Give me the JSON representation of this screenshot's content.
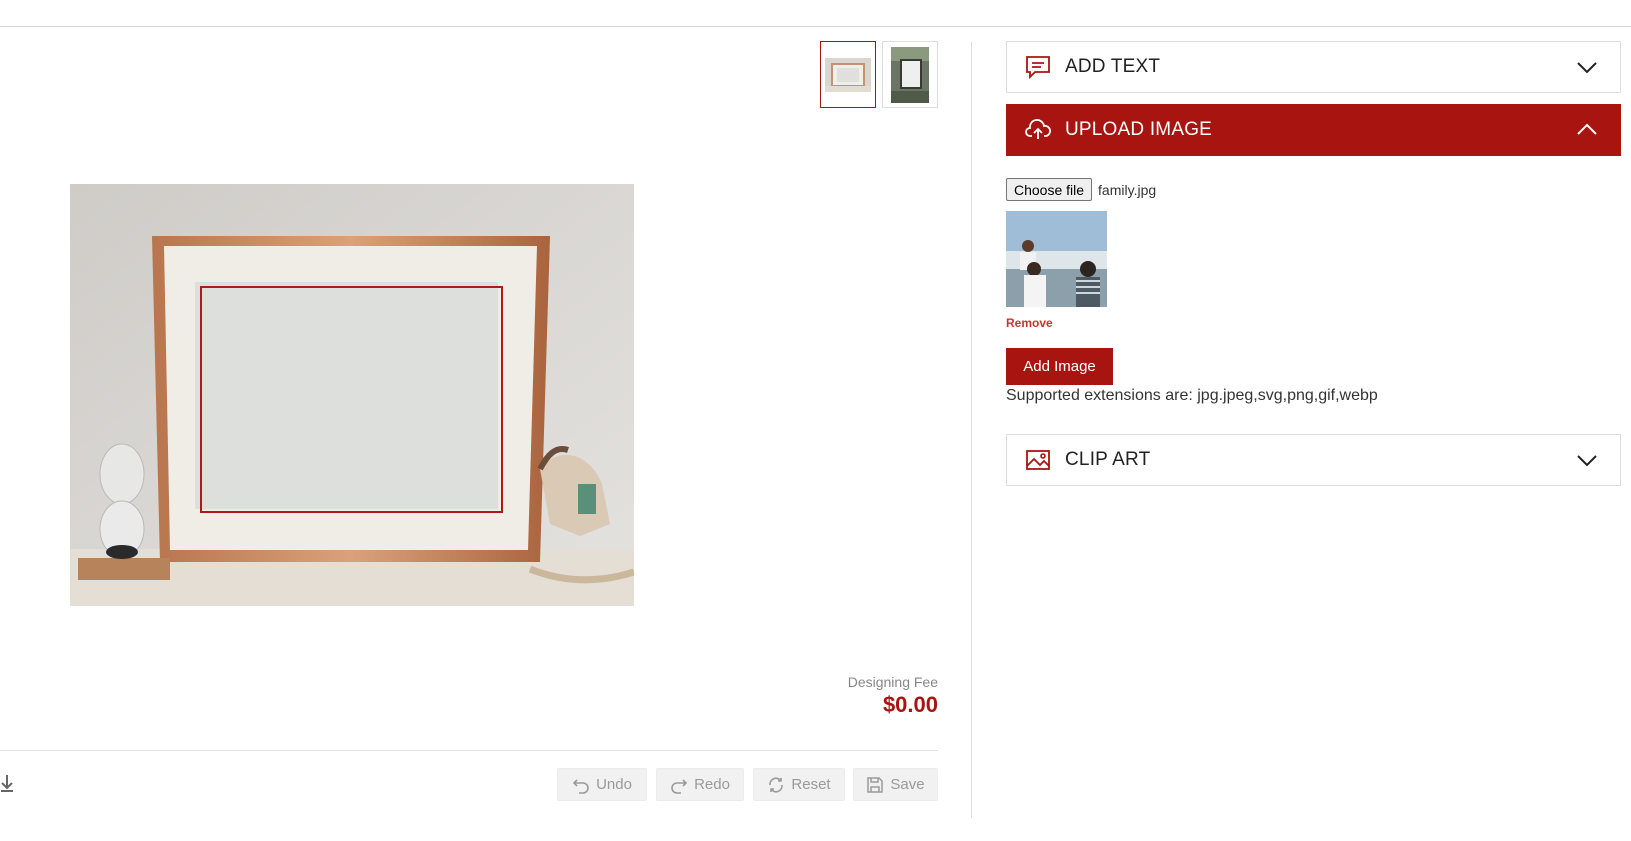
{
  "thumbnails": [
    {
      "name": "frame-landscape-view",
      "selected": true
    },
    {
      "name": "frame-portrait-view",
      "selected": false
    }
  ],
  "fee": {
    "label": "Designing Fee",
    "value": "$0.00"
  },
  "toolbar": {
    "undo_label": "Undo",
    "redo_label": "Redo",
    "reset_label": "Reset",
    "save_label": "Save"
  },
  "panels": {
    "add_text": {
      "label": "ADD TEXT",
      "icon": "chat-text-icon",
      "expanded": false
    },
    "upload_image": {
      "label": "UPLOAD IMAGE",
      "icon": "cloud-upload-icon",
      "expanded": true
    },
    "clip_art": {
      "label": "CLIP ART",
      "icon": "image-icon",
      "expanded": false
    }
  },
  "upload": {
    "choose_label": "Choose file",
    "file_name": "family.jpg",
    "remove_label": "Remove",
    "add_button": "Add Image",
    "supported": "Supported extensions are: jpg.jpeg,svg,png,gif,webp"
  },
  "colors": {
    "accent": "#a81510",
    "design_border": "#b0181b"
  }
}
